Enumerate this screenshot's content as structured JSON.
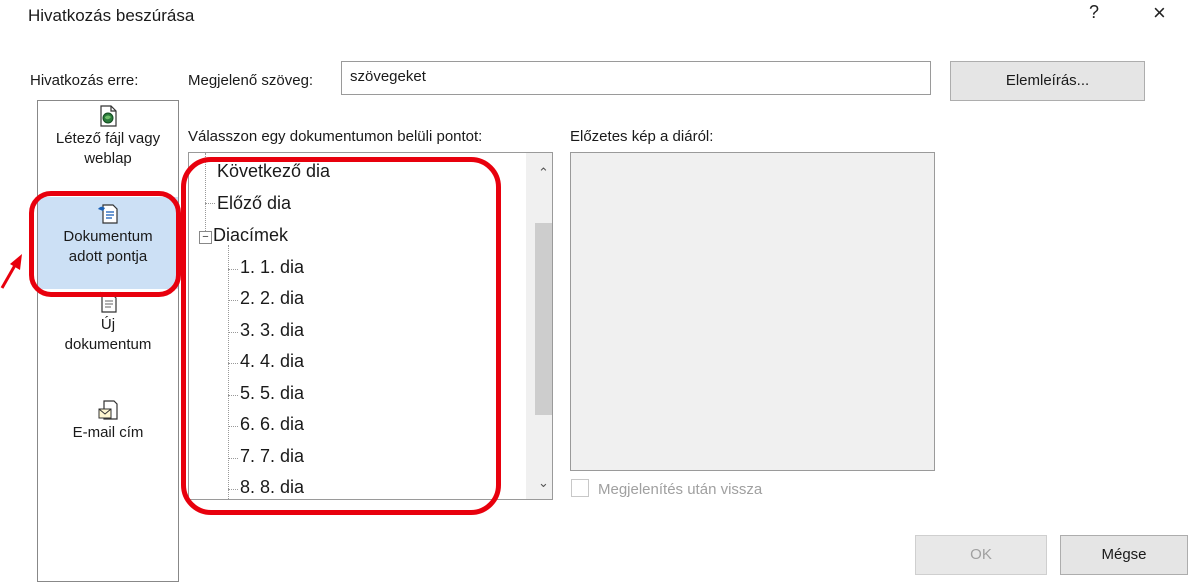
{
  "dialog": {
    "title": "Hivatkozás beszúrása",
    "help": "?",
    "close": "×"
  },
  "link_to": {
    "label": "Hivatkozás erre:",
    "items": [
      {
        "label_line1": "Létező fájl vagy",
        "label_line2": "weblap",
        "icon": "web-file-icon"
      },
      {
        "label_line1": "Dokumentum",
        "label_line2": "adott pontja",
        "icon": "document-place-icon",
        "selected": true
      },
      {
        "label_line1": "Új",
        "label_line2": "dokumentum",
        "icon": "new-document-icon"
      },
      {
        "label_line1": "E-mail cím",
        "label_line2": "",
        "icon": "email-icon"
      }
    ]
  },
  "display_text": {
    "label": "Megjelenő szöveg:",
    "value": "szövegeket"
  },
  "screentip_button": "Elemleírás...",
  "place_label": "Válasszon egy dokumentumon belüli pontot:",
  "tree": {
    "rows": [
      "Következő dia",
      "Előző dia",
      "Diacímek",
      "1. 1. dia",
      "2. 2. dia",
      "3. 3. dia",
      "4. 4. dia",
      "5. 5. dia",
      "6. 6. dia",
      "7. 7. dia",
      "8. 8. dia"
    ],
    "expander": "−"
  },
  "preview_label": "Előzetes kép a diáról:",
  "show_and_return": "Megjelenítés után vissza",
  "ok_button": "OK",
  "cancel_button": "Mégse",
  "colors": {
    "selection": "#cce0f5",
    "annotation": "#e8000d"
  }
}
